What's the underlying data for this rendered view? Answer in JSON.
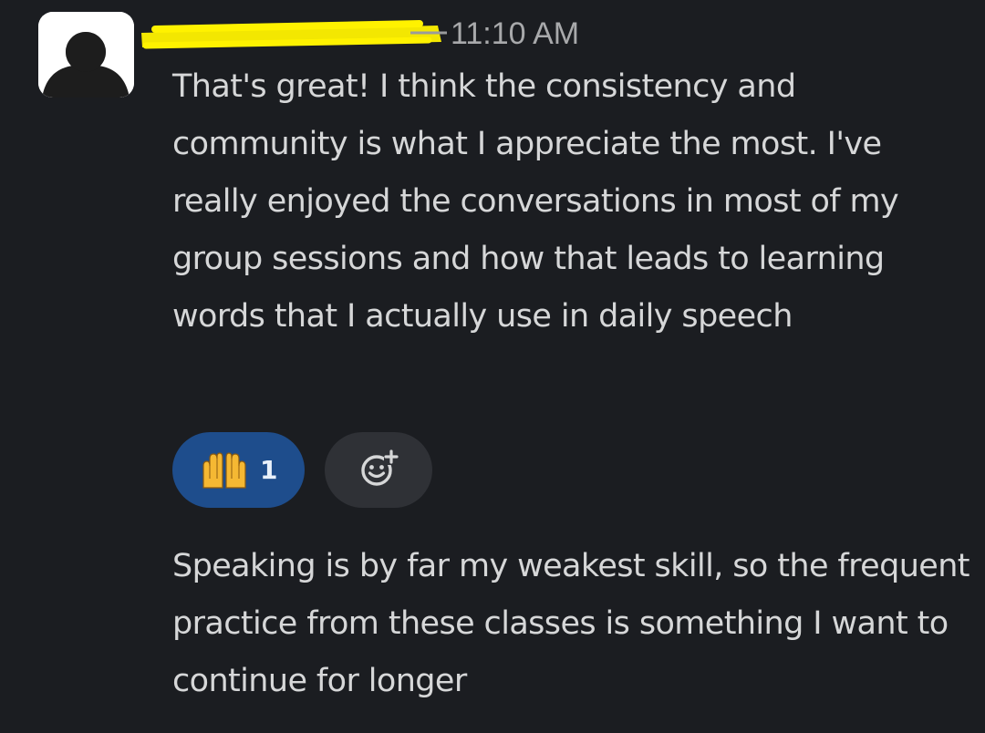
{
  "message": {
    "timestamp": "11:10 AM",
    "paragraphs": [
      "That's great! I think the consistency and community is what I appreciate the most. I've really enjoyed the conversations in most of my group sessions and how that leads to learning words that I actually use in daily speech",
      "Speaking is by far my weakest skill, so the frequent practice from these classes is something I want to continue for longer"
    ],
    "reactions": [
      {
        "emoji_icon": "raising-hands-icon",
        "count": "1"
      }
    ],
    "add_reaction_icon": "add-emoji-icon"
  },
  "colors": {
    "background": "#1b1d21",
    "text": "#d6d7d8",
    "timestamp": "#a8a9ab",
    "reaction_active": "#1e4d8c",
    "reaction_button": "#2f3136",
    "redaction_highlight": "#fff200"
  }
}
